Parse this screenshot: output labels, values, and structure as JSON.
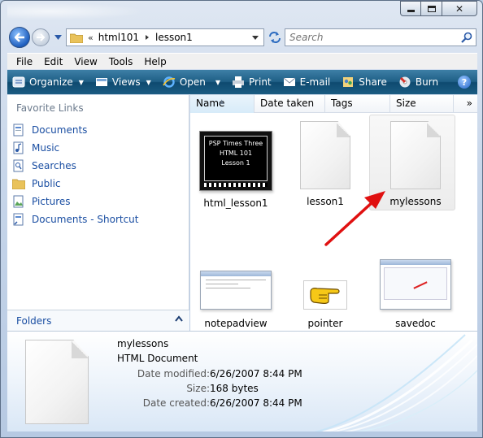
{
  "window": {
    "buttons": {
      "minimize": "minimize",
      "maximize": "maximize",
      "close": "close"
    }
  },
  "address": {
    "overflow": "«",
    "crumbs": [
      "html101",
      "lesson1"
    ],
    "search_placeholder": "Search"
  },
  "menu": [
    "File",
    "Edit",
    "View",
    "Tools",
    "Help"
  ],
  "commands": [
    {
      "label": "Organize",
      "icon": "organize-icon",
      "dropdown": true
    },
    {
      "label": "Views",
      "icon": "views-icon",
      "dropdown": true
    },
    {
      "label": "Open",
      "icon": "ie-icon",
      "dropdown": true
    },
    {
      "label": "Print",
      "icon": "printer-icon",
      "dropdown": false
    },
    {
      "label": "E-mail",
      "icon": "email-icon",
      "dropdown": false
    },
    {
      "label": "Share",
      "icon": "share-icon",
      "dropdown": false
    },
    {
      "label": "Burn",
      "icon": "burn-icon",
      "dropdown": false
    }
  ],
  "help_label": "?",
  "nav": {
    "title": "Favorite Links",
    "items": [
      {
        "label": "Documents",
        "icon": "documents-icon"
      },
      {
        "label": "Music",
        "icon": "music-icon"
      },
      {
        "label": "Searches",
        "icon": "searches-icon"
      },
      {
        "label": "Public",
        "icon": "public-folder-icon"
      },
      {
        "label": "Pictures",
        "icon": "pictures-icon"
      },
      {
        "label": "Documents - Shortcut",
        "icon": "documents-shortcut-icon"
      }
    ],
    "folders_label": "Folders"
  },
  "columns": [
    "Name",
    "Date taken",
    "Tags",
    "Size"
  ],
  "more_columns": "»",
  "files": [
    {
      "name": "html_lesson1",
      "thumb_lines": [
        "PSP Times Three",
        "HTML 101",
        "Lesson 1"
      ]
    },
    {
      "name": "lesson1"
    },
    {
      "name": "mylessons",
      "selected": true
    },
    {
      "name": "notepadview"
    },
    {
      "name": "pointer"
    },
    {
      "name": "savedoc"
    }
  ],
  "details": {
    "name": "mylessons",
    "type": "HTML Document",
    "rows": [
      {
        "key": "Date modified:",
        "value": "6/26/2007 8:44 PM"
      },
      {
        "key": "Size:",
        "value": "168 bytes"
      },
      {
        "key": "Date created:",
        "value": "6/26/2007 8:44 PM"
      }
    ]
  },
  "colors": {
    "command_bar": "#1f5f86",
    "link_blue": "#1a4ea2",
    "annotation_arrow": "#e01010"
  }
}
